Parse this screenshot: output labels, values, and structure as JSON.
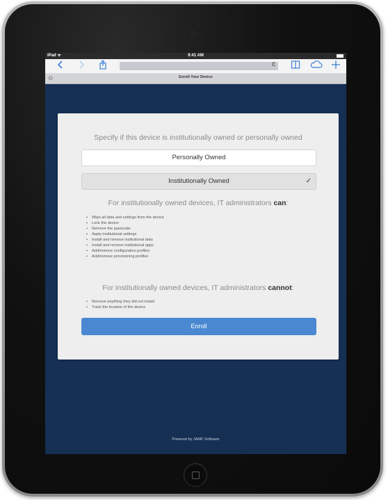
{
  "statusbar": {
    "carrier": "iPad ᯤ",
    "time": "9:41 AM"
  },
  "toolbar": {
    "back_icon": "chevron-left-icon",
    "forward_icon": "chevron-right-icon",
    "share_icon": "share-icon",
    "reload_icon": "reload-icon",
    "bookmarks_icon": "book-icon",
    "cloud_icon": "cloud-icon",
    "add_icon": "plus-icon",
    "reload_glyph": "c"
  },
  "tab": {
    "title": "Enroll Your Device",
    "close_glyph": "⊖"
  },
  "card": {
    "prompt": "Specify if this device is institutionally owned or personally owned",
    "option_personal": "Personally Owned",
    "option_institutional": "Institutionally Owned",
    "option_institutional_selected": true,
    "checkmark": "✓",
    "heading_can_prefix": "For institutionally owned devices, IT administrators ",
    "heading_can_bold": "can",
    "heading_can_suffix": ":",
    "can_items": [
      "Wipe all data and settings from the device",
      "Lock the device",
      "Remove the passcode",
      "Apply institutional settings",
      "Install and remove institutional data",
      "Install and remove institutional apps",
      "Add/remove configuration profiles",
      "Add/remove provisioning profiles"
    ],
    "heading_cannot_prefix": "For institutionally owned devices, IT administrators ",
    "heading_cannot_bold": "cannot",
    "heading_cannot_suffix": ":",
    "cannot_items": [
      "Remove anything they did not install",
      "Track the location of the device"
    ],
    "enroll_label": "Enroll"
  },
  "footer": {
    "text": "Powered by JAMF Software"
  },
  "colors": {
    "page_background": "#163054",
    "accent": "#4a88d1",
    "toolbar_icon": "#3b7fd6"
  }
}
